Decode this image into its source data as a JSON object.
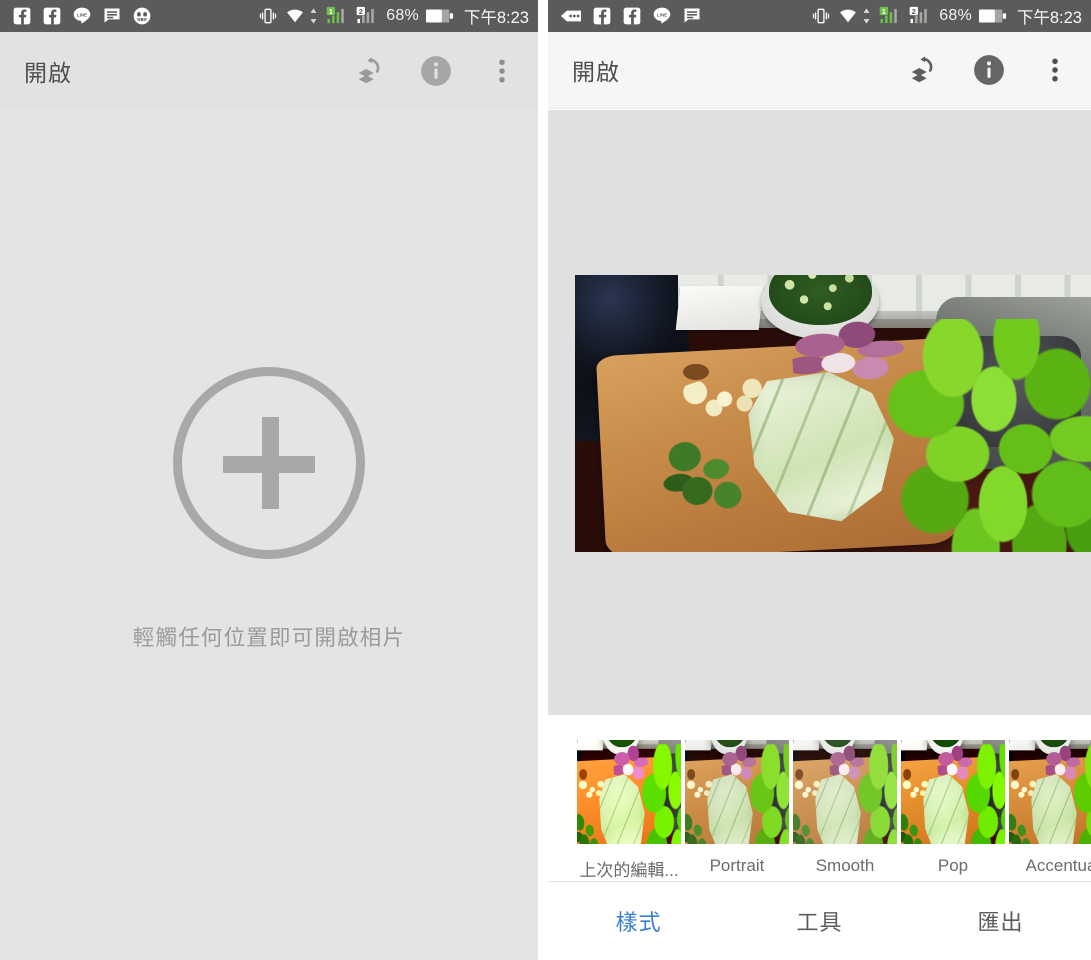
{
  "status_bar": {
    "left_panel": {
      "notification_icons": [
        "facebook-icon",
        "facebook-icon",
        "line-icon",
        "news-message-icon",
        "skull-face-icon"
      ],
      "vibrate_icon": "vibrate-icon",
      "wifi_icon": "wifi-icon",
      "sim1_label": "1",
      "sim2_label": "2",
      "battery_percent": "68%",
      "time": "下午8:23"
    },
    "right_panel": {
      "notification_icons": [
        "more-notifications-icon",
        "facebook-icon",
        "facebook-icon",
        "line-icon",
        "news-message-icon"
      ],
      "vibrate_icon": "vibrate-icon",
      "wifi_icon": "wifi-icon",
      "sim1_label": "1",
      "sim2_label": "2",
      "battery_percent": "68%",
      "time": "下午8:23"
    }
  },
  "left_screen": {
    "toolbar": {
      "title": "開啟",
      "revert_icon": "revert-layers-icon",
      "info_icon": "info-icon",
      "overflow_icon": "overflow-menu-icon"
    },
    "empty_state": {
      "add_icon": "plus-circle-icon",
      "hint": "輕觸任何位置即可開啟相片"
    }
  },
  "right_screen": {
    "toolbar": {
      "title": "開啟",
      "revert_icon": "revert-layers-icon",
      "info_icon": "info-icon",
      "overflow_icon": "overflow-menu-icon"
    },
    "photo": {
      "alt": "kitchen-cutting-board-vegetables-photo"
    },
    "filters": [
      {
        "label": "上次的編輯...",
        "variant": "v-lastedit"
      },
      {
        "label": "Portrait",
        "variant": "v-portrait"
      },
      {
        "label": "Smooth",
        "variant": "v-smooth"
      },
      {
        "label": "Pop",
        "variant": "v-pop"
      },
      {
        "label": "Accentua",
        "variant": "v-accent"
      }
    ],
    "tabs": [
      {
        "label": "樣式",
        "active": true
      },
      {
        "label": "工具",
        "active": false
      },
      {
        "label": "匯出",
        "active": false
      }
    ]
  },
  "colors": {
    "statusbar_bg": "#5b5b5b",
    "accent_blue": "#3c7fd0",
    "signal_green": "#6cc04a",
    "panel_bg": "#e2e2e2"
  }
}
